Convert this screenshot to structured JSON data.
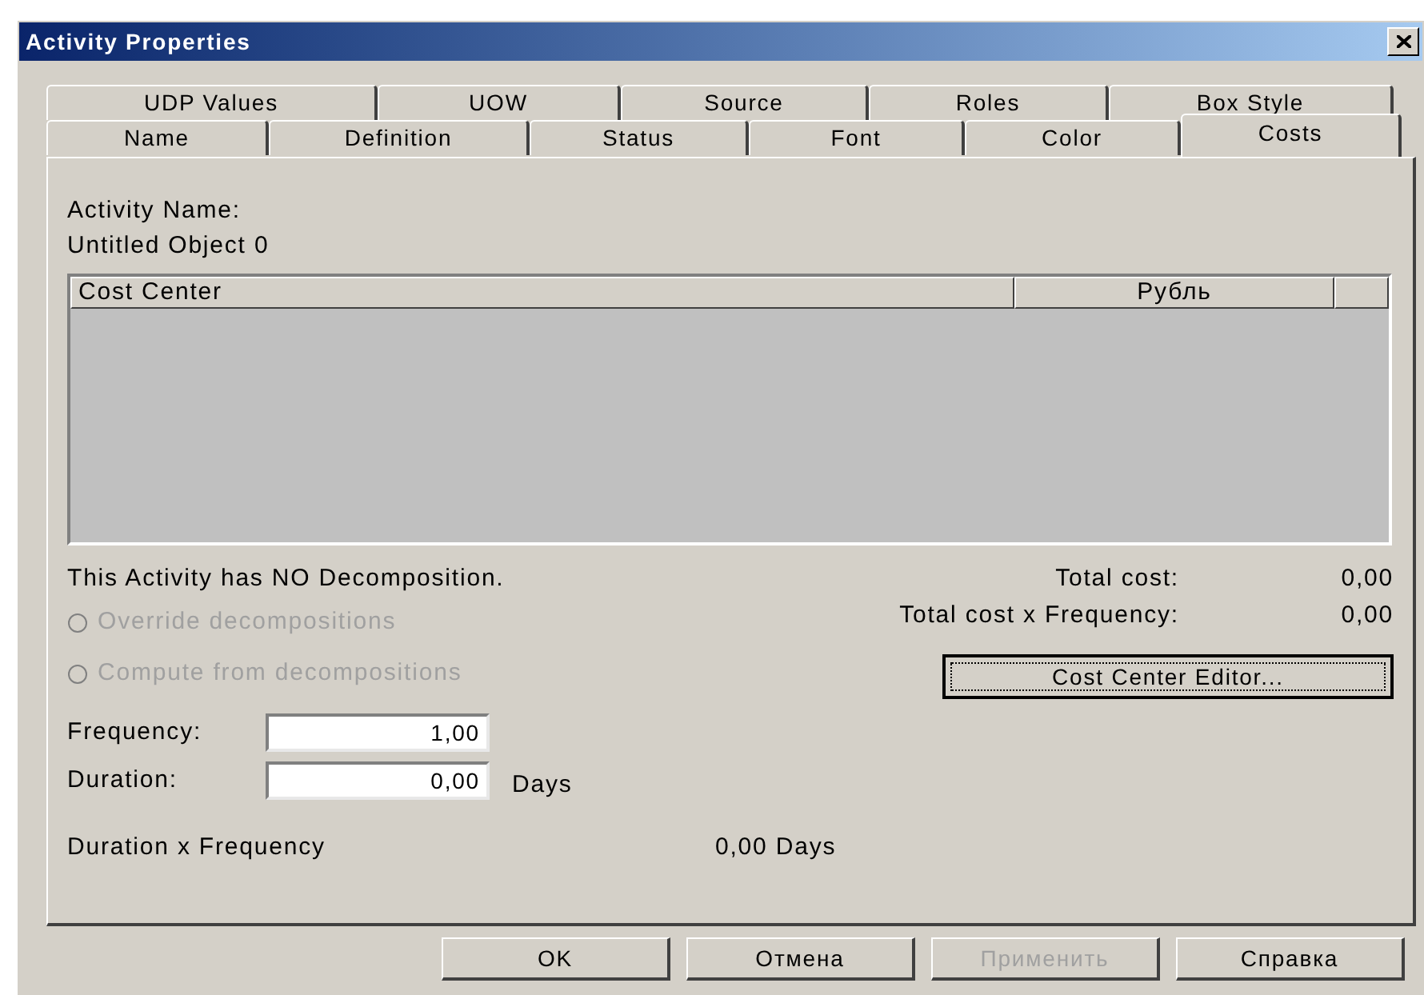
{
  "window": {
    "title": "Activity Properties"
  },
  "tab_rows": [
    [
      {
        "label": "UDP Values",
        "selected": false
      },
      {
        "label": "UOW",
        "selected": false
      },
      {
        "label": "Source",
        "selected": false
      },
      {
        "label": "Roles",
        "selected": false
      },
      {
        "label": "Box Style",
        "selected": false
      }
    ],
    [
      {
        "label": "Name",
        "selected": false
      },
      {
        "label": "Definition",
        "selected": false
      },
      {
        "label": "Status",
        "selected": false
      },
      {
        "label": "Font",
        "selected": false
      },
      {
        "label": "Color",
        "selected": false
      },
      {
        "label": "Costs",
        "selected": true
      }
    ]
  ],
  "activity_name": {
    "label": "Activity Name:",
    "value": "Untitled Object 0"
  },
  "table": {
    "columns": [
      "Cost Center",
      "Рубль"
    ]
  },
  "decomposition_note": "This Activity has NO Decomposition.",
  "radios": [
    {
      "label": "Override decompositions",
      "checked": false,
      "disabled": true
    },
    {
      "label": "Compute from decompositions",
      "checked": false,
      "disabled": true
    }
  ],
  "totals": [
    {
      "label": "Total cost:",
      "value": "0,00"
    },
    {
      "label": "Total cost x Frequency:",
      "value": "0,00"
    }
  ],
  "cost_center_button": {
    "label": "Cost Center Editor..."
  },
  "fields": [
    {
      "label": "Frequency:",
      "value": "1,00"
    },
    {
      "label": "Duration:",
      "value": "0,00",
      "unit": "Days"
    }
  ],
  "product": {
    "label": "Duration x Frequency",
    "value": "0,00 Days"
  },
  "buttons": [
    {
      "label": "OK",
      "disabled": false
    },
    {
      "label": "Отмена",
      "disabled": false
    },
    {
      "label": "Применить",
      "disabled": true
    },
    {
      "label": "Справка",
      "disabled": false
    }
  ]
}
